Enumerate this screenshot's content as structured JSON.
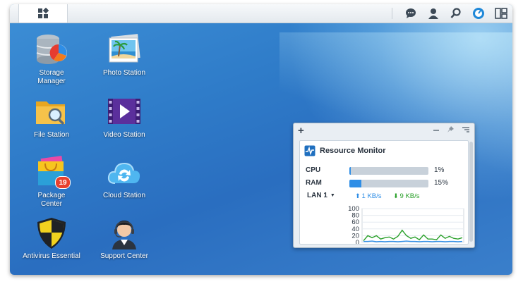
{
  "desktop": {
    "apps": [
      {
        "label": "Storage\nManager"
      },
      {
        "label": "Photo Station"
      },
      {
        "label": "File Station"
      },
      {
        "label": "Video Station"
      },
      {
        "label": "Package\nCenter",
        "badge": "19"
      },
      {
        "label": "Cloud Station"
      },
      {
        "label": "Antivirus Essential"
      },
      {
        "label": "Support Center"
      }
    ]
  },
  "taskbar": {
    "icons": [
      "chat-icon",
      "user-icon",
      "search-icon",
      "dashboard-icon",
      "widgets-icon"
    ]
  },
  "widget": {
    "title": "Resource Monitor",
    "cpu": {
      "label": "CPU",
      "value": "1%",
      "fraction": 0.01
    },
    "ram": {
      "label": "RAM",
      "value": "15%",
      "fraction": 0.15
    },
    "lan": {
      "label": "LAN 1",
      "up": "1 KB/s",
      "down": "9 KB/s"
    },
    "colors": {
      "up": "#2f8ee6",
      "down": "#2aa02a"
    }
  },
  "chart_data": {
    "type": "line",
    "ylim": [
      0,
      100
    ],
    "yticks": [
      "100",
      "80",
      "60",
      "40",
      "20",
      "0"
    ],
    "series": [
      {
        "values": [
          5,
          20,
          14,
          20,
          10,
          14,
          16,
          10,
          18,
          36,
          20,
          12,
          16,
          8,
          22,
          10,
          10,
          8,
          22,
          12,
          18,
          12,
          10,
          14
        ]
      },
      {
        "values": [
          3,
          3,
          4,
          2,
          3,
          2,
          3,
          3,
          2,
          3,
          4,
          3,
          3,
          2,
          3,
          3,
          2,
          3,
          3,
          2,
          3,
          3,
          2,
          3
        ]
      }
    ]
  }
}
